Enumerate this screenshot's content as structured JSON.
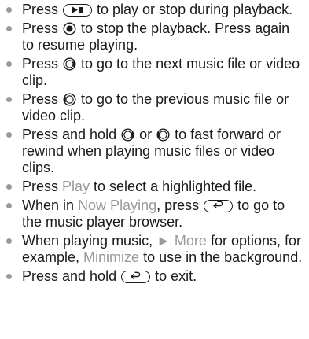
{
  "items": [
    {
      "pre": "Press ",
      "post": " to play or stop during playback."
    },
    {
      "pre": "Press ",
      "post": " to stop the playback. Press again to resume playing."
    },
    {
      "pre": "Press ",
      "post": " to go to the next music file or video clip."
    },
    {
      "pre": "Press ",
      "post": " to go to the previous music file or video clip."
    },
    {
      "pre": "Press and hold ",
      "mid": " or ",
      "post": " to fast forward or rewind when playing music files or video clips."
    },
    {
      "pre": "Press ",
      "hl": "Play",
      "post": " to select a highlighted file."
    },
    {
      "pre": "When in ",
      "hl": "Now Playing",
      "mid": ", press ",
      "post": " to go to the music player browser."
    },
    {
      "pre": "When playing music, ",
      "arrow": "►",
      "hl": "More",
      "mid": " for options, for example, ",
      "hl2": "Minimize",
      "post": " to use in the background."
    },
    {
      "pre": "Press and hold ",
      "post": " to exit."
    }
  ]
}
